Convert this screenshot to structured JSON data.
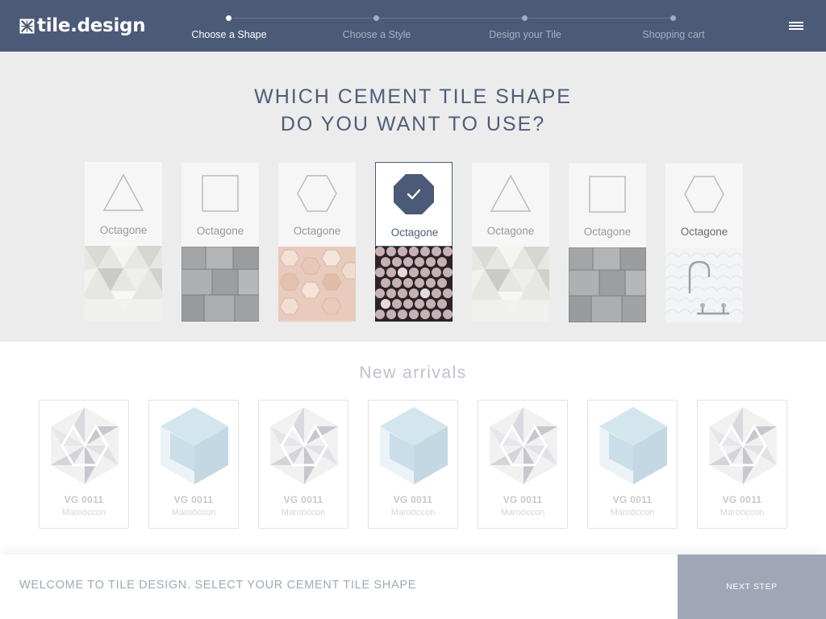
{
  "app": {
    "brand": "tile.design",
    "logo_icon": "tile-logo-icon",
    "menu_icon": "hamburger-menu-icon"
  },
  "steps": [
    {
      "label": "Choose a Shape",
      "active": true
    },
    {
      "label": "Choose a Style",
      "active": false
    },
    {
      "label": "Design your Tile",
      "active": false
    },
    {
      "label": "Shopping cart",
      "active": false
    }
  ],
  "hero": {
    "line1": "WHICH CEMENT TILE SHAPE",
    "line2": "DO YOU WANT TO USE?"
  },
  "shapes": [
    {
      "shape": "triangle",
      "name": "Octagone",
      "selected": false
    },
    {
      "shape": "square",
      "name": "Octagone",
      "selected": false
    },
    {
      "shape": "hexagon",
      "name": "Octagone",
      "selected": false
    },
    {
      "shape": "octagon",
      "name": "Octagone",
      "selected": true
    },
    {
      "shape": "triangle",
      "name": "Octagone",
      "selected": false
    },
    {
      "shape": "square",
      "name": "Octagone",
      "selected": false
    },
    {
      "shape": "hexagon",
      "name": "Octagone",
      "selected": false
    }
  ],
  "new_arrivals": {
    "title": "New arrivals",
    "items": [
      {
        "code": "VG 0011",
        "subtitle": "Maroöccon",
        "pattern": "star"
      },
      {
        "code": "VG 0011",
        "subtitle": "Maroöccon",
        "pattern": "cube"
      },
      {
        "code": "VG 0011",
        "subtitle": "Maroöccon",
        "pattern": "star"
      },
      {
        "code": "VG 0011",
        "subtitle": "Maroöccon",
        "pattern": "cube"
      },
      {
        "code": "VG 0011",
        "subtitle": "Maroöccon",
        "pattern": "star"
      },
      {
        "code": "VG 0011",
        "subtitle": "Maroöccon",
        "pattern": "cube"
      },
      {
        "code": "VG 0011",
        "subtitle": "Maroöccon",
        "pattern": "star"
      }
    ]
  },
  "footer": {
    "message": "WELCOME TO TILE DESIGN. SELECT YOUR CEMENT TILE SHAPE",
    "next_label": "NEXT STEP"
  },
  "colors": {
    "header_bg": "#4b5a77",
    "accent": "#4b5a77",
    "next_button_bg": "#a0a6b5",
    "section_bg": "#ececec"
  }
}
